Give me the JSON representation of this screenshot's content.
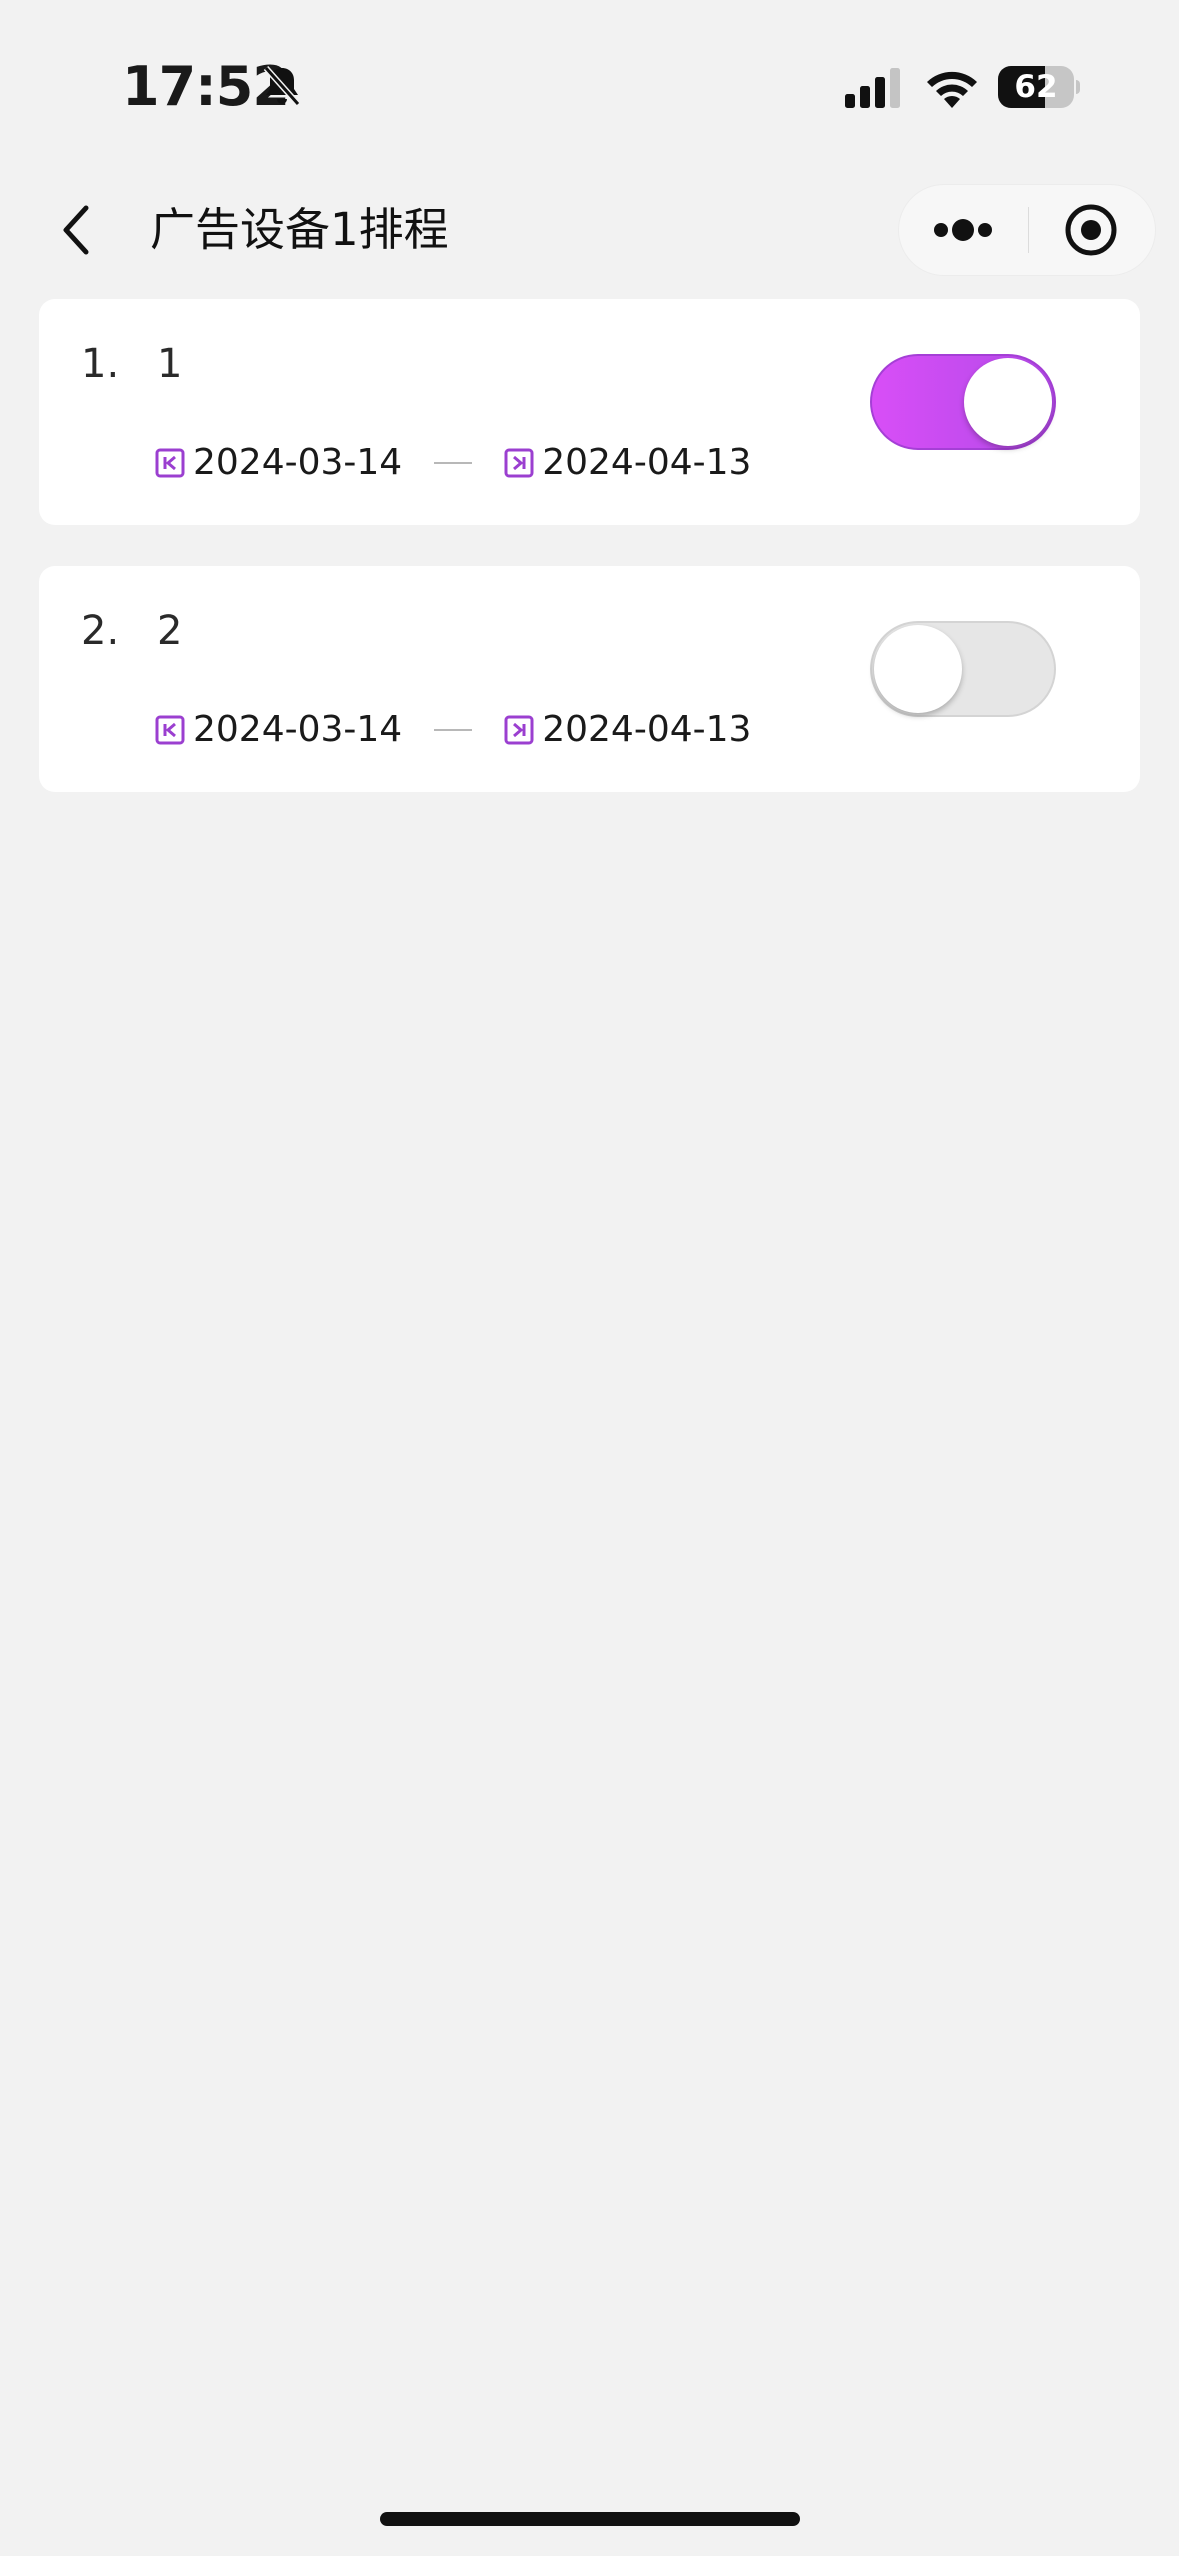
{
  "status_bar": {
    "time": "17:52",
    "battery_level": "62",
    "battery_percent": 62,
    "icons": [
      "bell-muted-icon",
      "signal-icon",
      "wifi-icon",
      "battery-icon"
    ]
  },
  "nav": {
    "title": "广告设备1排程",
    "back_icon": "chevron-left-icon",
    "more_icon": "more-dots-icon",
    "close_icon": "target-circle-icon"
  },
  "colors": {
    "accent": "#c34af0",
    "accent_dark": "#a53fd6",
    "date_icon": "#9b3fd0",
    "background": "#f2f2f2",
    "card": "#ffffff"
  },
  "schedules": [
    {
      "index": "1.",
      "name": "1",
      "start_date": "2024-03-14",
      "end_date": "2024-04-13",
      "enabled": true
    },
    {
      "index": "2.",
      "name": "2",
      "start_date": "2024-03-14",
      "end_date": "2024-04-13",
      "enabled": false
    }
  ]
}
